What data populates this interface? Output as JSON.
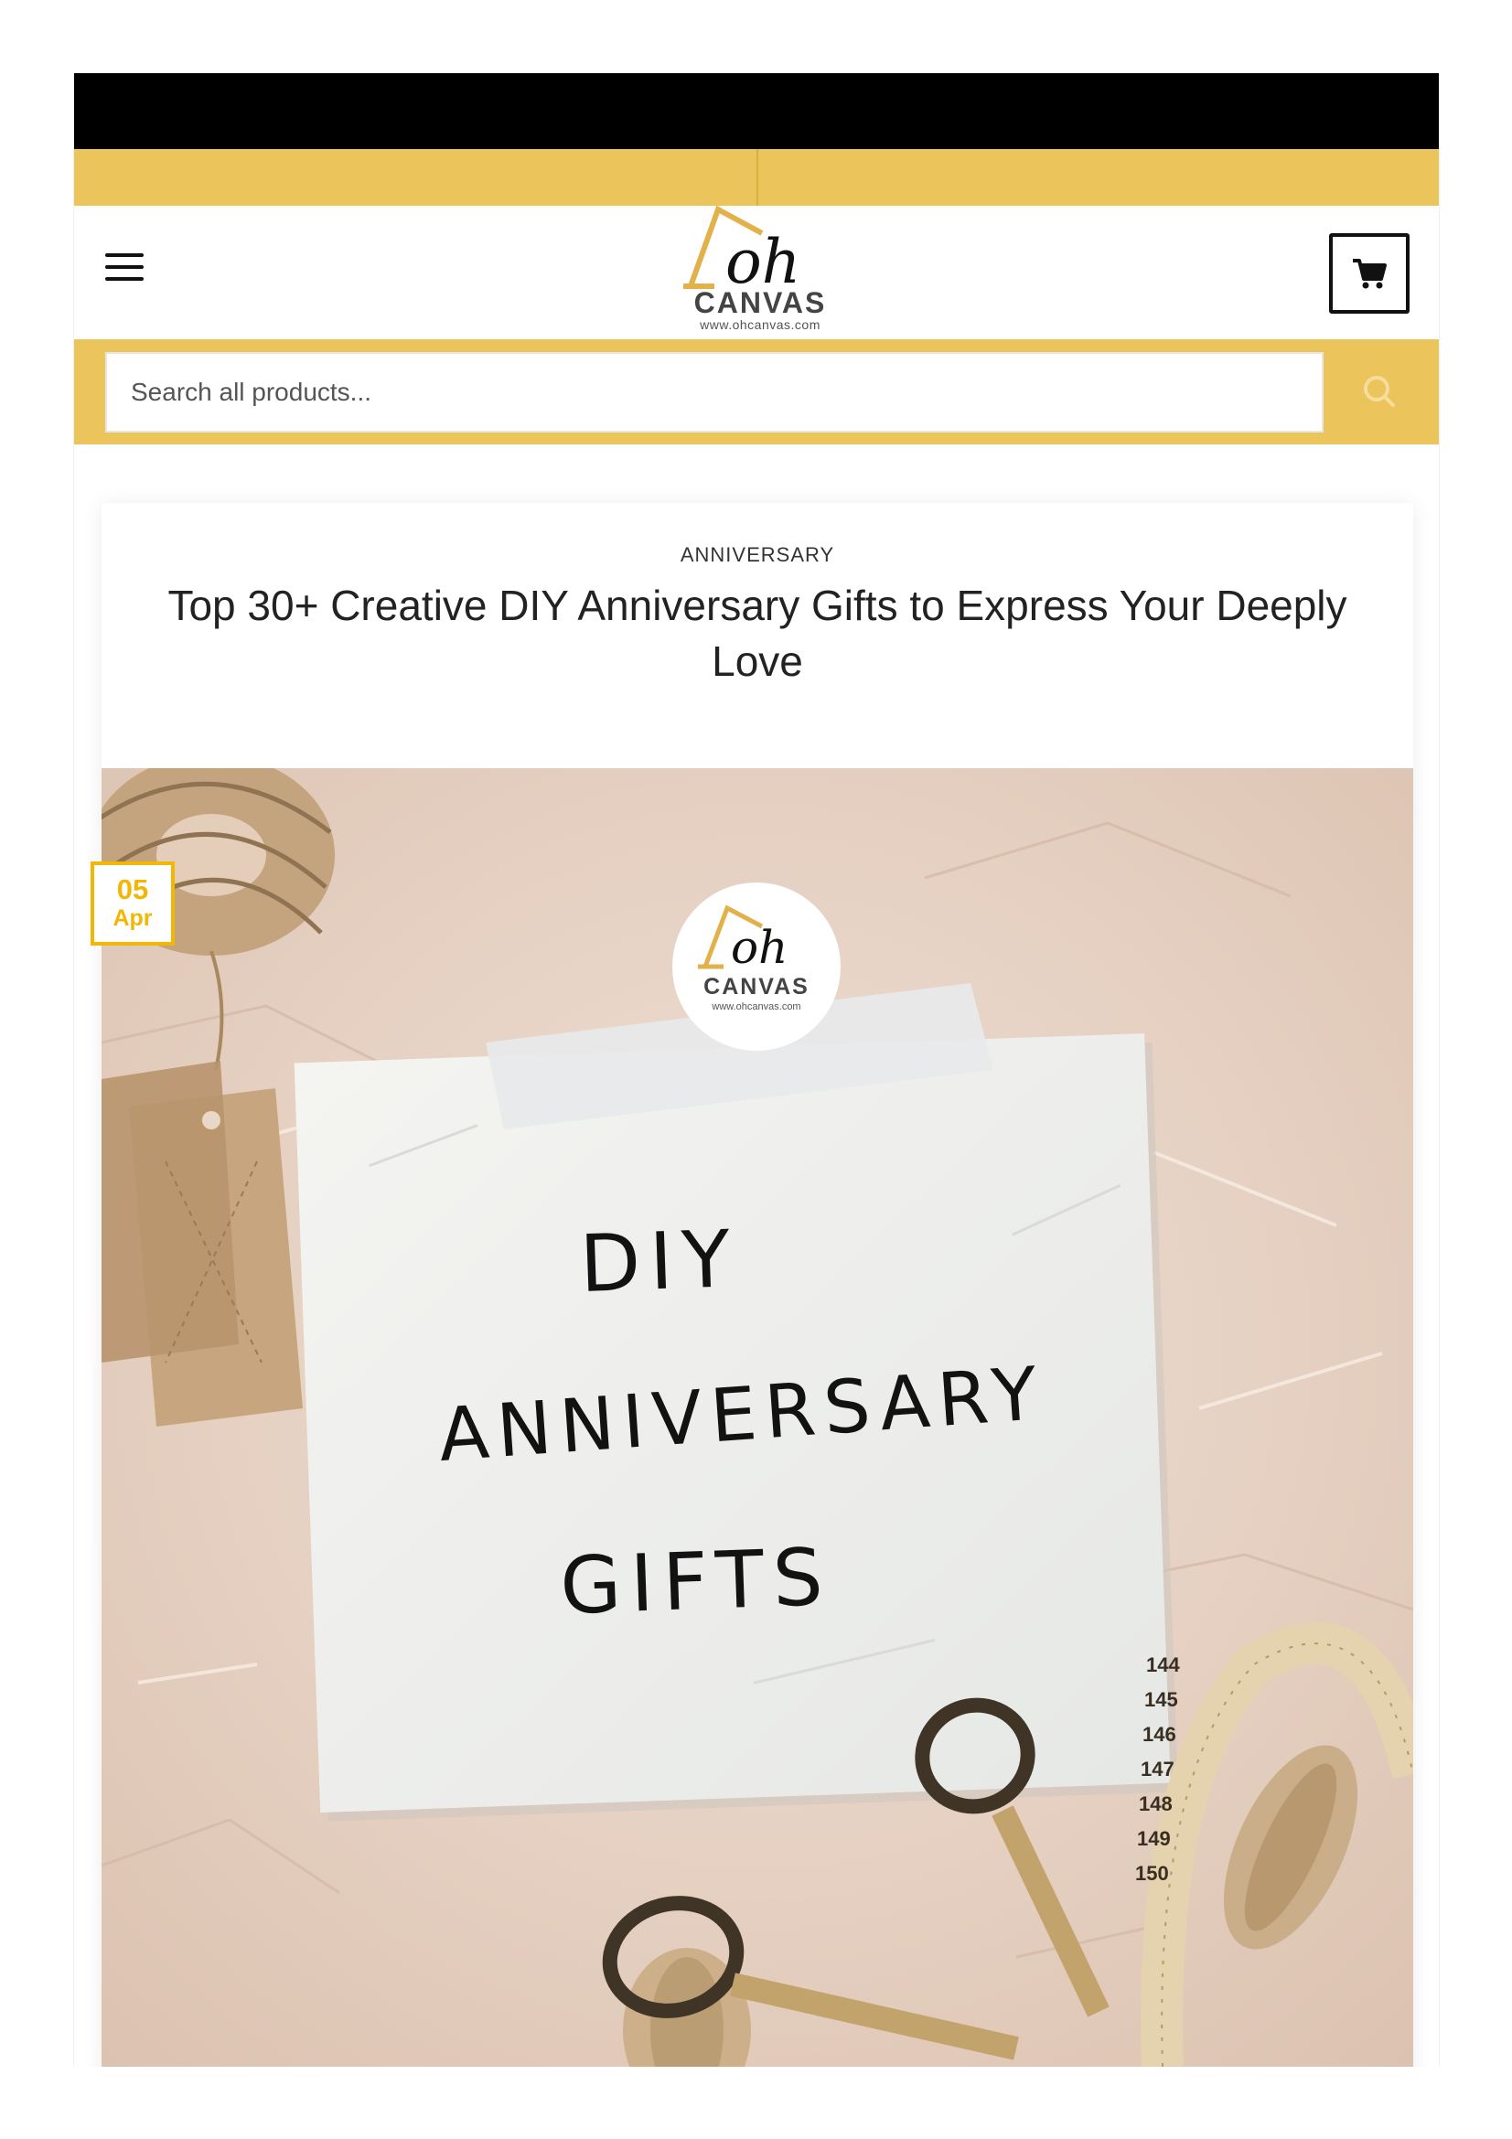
{
  "header": {
    "logo": {
      "script": "oh",
      "name": "CANVAS",
      "url": "www.ohcanvas.com"
    }
  },
  "search": {
    "placeholder": "Search all products..."
  },
  "article": {
    "category": "ANNIVERSARY",
    "title": "Top 30+ Creative DIY Anniversary Gifts to Express Your Deeply Love",
    "date": {
      "day": "05",
      "month": "Apr"
    },
    "image": {
      "sticker": {
        "name": "CANVAS",
        "url": "www.ohcanvas.com"
      },
      "lines": [
        "DIY",
        "ANNIVERSARY",
        "GIFTS"
      ],
      "tape_numbers": [
        "144",
        "145",
        "146",
        "147",
        "148",
        "149",
        "150"
      ]
    }
  },
  "colors": {
    "top_bar": "#000000",
    "accent_yellow": "#ecc45c",
    "date_badge": "#f2b705",
    "text_dark": "#222222"
  }
}
